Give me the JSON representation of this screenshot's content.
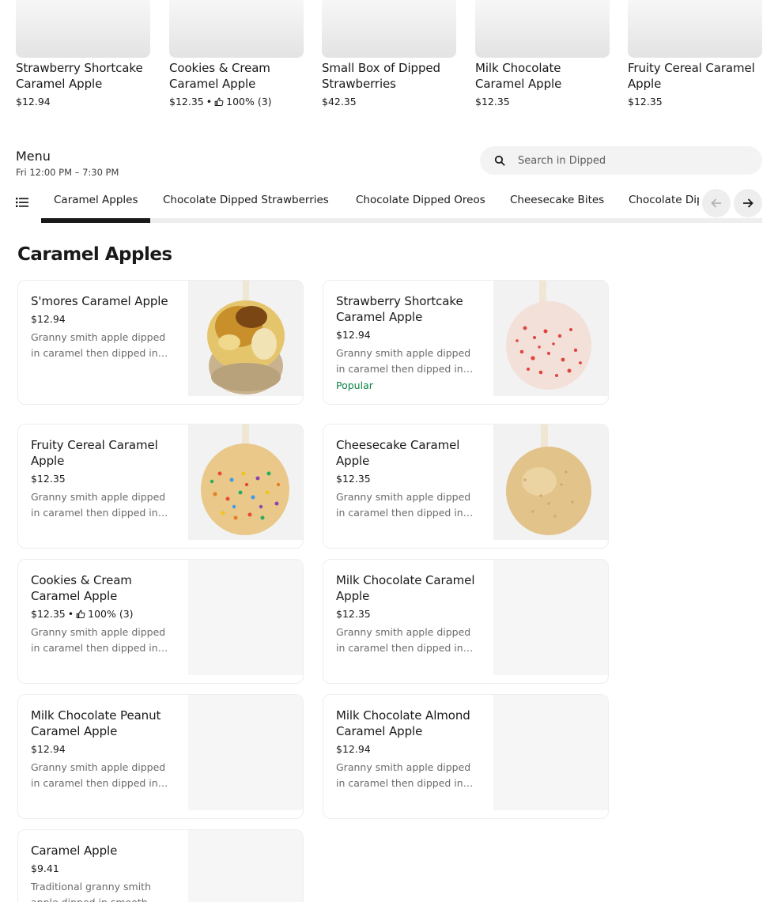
{
  "carousel": [
    {
      "name": "Strawberry Shortcake Caramel Apple",
      "price": "$12.94",
      "rating": ""
    },
    {
      "name": "Cookies & Cream Caramel Apple",
      "price": "$12.35",
      "rating": "100% (3)"
    },
    {
      "name": "Small Box of Dipped Strawberries",
      "price": "$42.35",
      "rating": ""
    },
    {
      "name": "Milk Chocolate Caramel Apple",
      "price": "$12.35",
      "rating": ""
    },
    {
      "name": "Fruity Cereal Caramel Apple",
      "price": "$12.35",
      "rating": ""
    }
  ],
  "menu": {
    "title": "Menu",
    "hours": "Fri 12:00 PM – 7:30 PM",
    "search_placeholder": "Search in Dipped"
  },
  "tabs": [
    {
      "label": "Caramel Apples",
      "active": true
    },
    {
      "label": "Chocolate Dipped Strawberries",
      "active": false
    },
    {
      "label": "Chocolate Dipped Oreos",
      "active": false
    },
    {
      "label": "Cheesecake Bites",
      "active": false
    },
    {
      "label": "Chocolate Dipped Pretzels",
      "active": false
    }
  ],
  "section": {
    "title": "Caramel Apples",
    "items": [
      {
        "name": "S'mores Caramel Apple",
        "price": "$12.94",
        "rating": "",
        "description": "Granny smith apple dipped in caramel then dipped in marshmallow and graham cracker.",
        "badge": "",
        "image": "smores-apple"
      },
      {
        "name": "Strawberry Shortcake Caramel Apple",
        "price": "$12.94",
        "rating": "",
        "description": "Granny smith apple dipped in caramel then dipped in white chocolate and strawberry crumble.",
        "badge": "Popular",
        "image": "strawberry-shortcake-apple"
      },
      {
        "name": "Fruity Cereal Caramel Apple",
        "price": "$12.35",
        "rating": "",
        "description": "Granny smith apple dipped in caramel then dipped in white chocolate and fruity cereal.",
        "badge": "",
        "image": "fruity-cereal-apple"
      },
      {
        "name": "Cheesecake Caramel Apple",
        "price": "$12.35",
        "rating": "",
        "description": "Granny smith apple dipped in caramel then dipped in white chocolate and cheesecake crumble.",
        "badge": "",
        "image": "cheesecake-apple"
      },
      {
        "name": "Cookies & Cream Caramel Apple",
        "price": "$12.35",
        "rating": "100% (3)",
        "description": "Granny smith apple dipped in caramel then dipped in white chocolate and cookie crumble.",
        "badge": "",
        "image": ""
      },
      {
        "name": "Milk Chocolate Caramel Apple",
        "price": "$12.35",
        "rating": "",
        "description": "Granny smith apple dipped in caramel then dipped in milk chocolate.",
        "badge": "",
        "image": ""
      },
      {
        "name": "Milk Chocolate Peanut Caramel Apple",
        "price": "$12.94",
        "rating": "",
        "description": "Granny smith apple dipped in caramel then dipped in milk chocolate and peanuts.",
        "badge": "",
        "image": ""
      },
      {
        "name": "Milk Chocolate Almond Caramel Apple",
        "price": "$12.94",
        "rating": "",
        "description": "Granny smith apple dipped in caramel then dipped in milk chocolate and almonds.",
        "badge": "",
        "image": ""
      },
      {
        "name": "Caramel Apple",
        "price": "$9.41",
        "rating": "",
        "description": "Traditional granny smith apple dipped in smooth caramel.",
        "badge": "",
        "image": ""
      }
    ]
  },
  "colors": {
    "text": "#191919",
    "muted": "#6b6b6b",
    "popular": "#0e8345",
    "border": "#eeeeee"
  },
  "icons": {
    "thumb": "thumbs-up-icon",
    "search": "search-icon",
    "menu_list": "list-icon",
    "prev": "arrow-left-icon",
    "next": "arrow-right-icon"
  }
}
